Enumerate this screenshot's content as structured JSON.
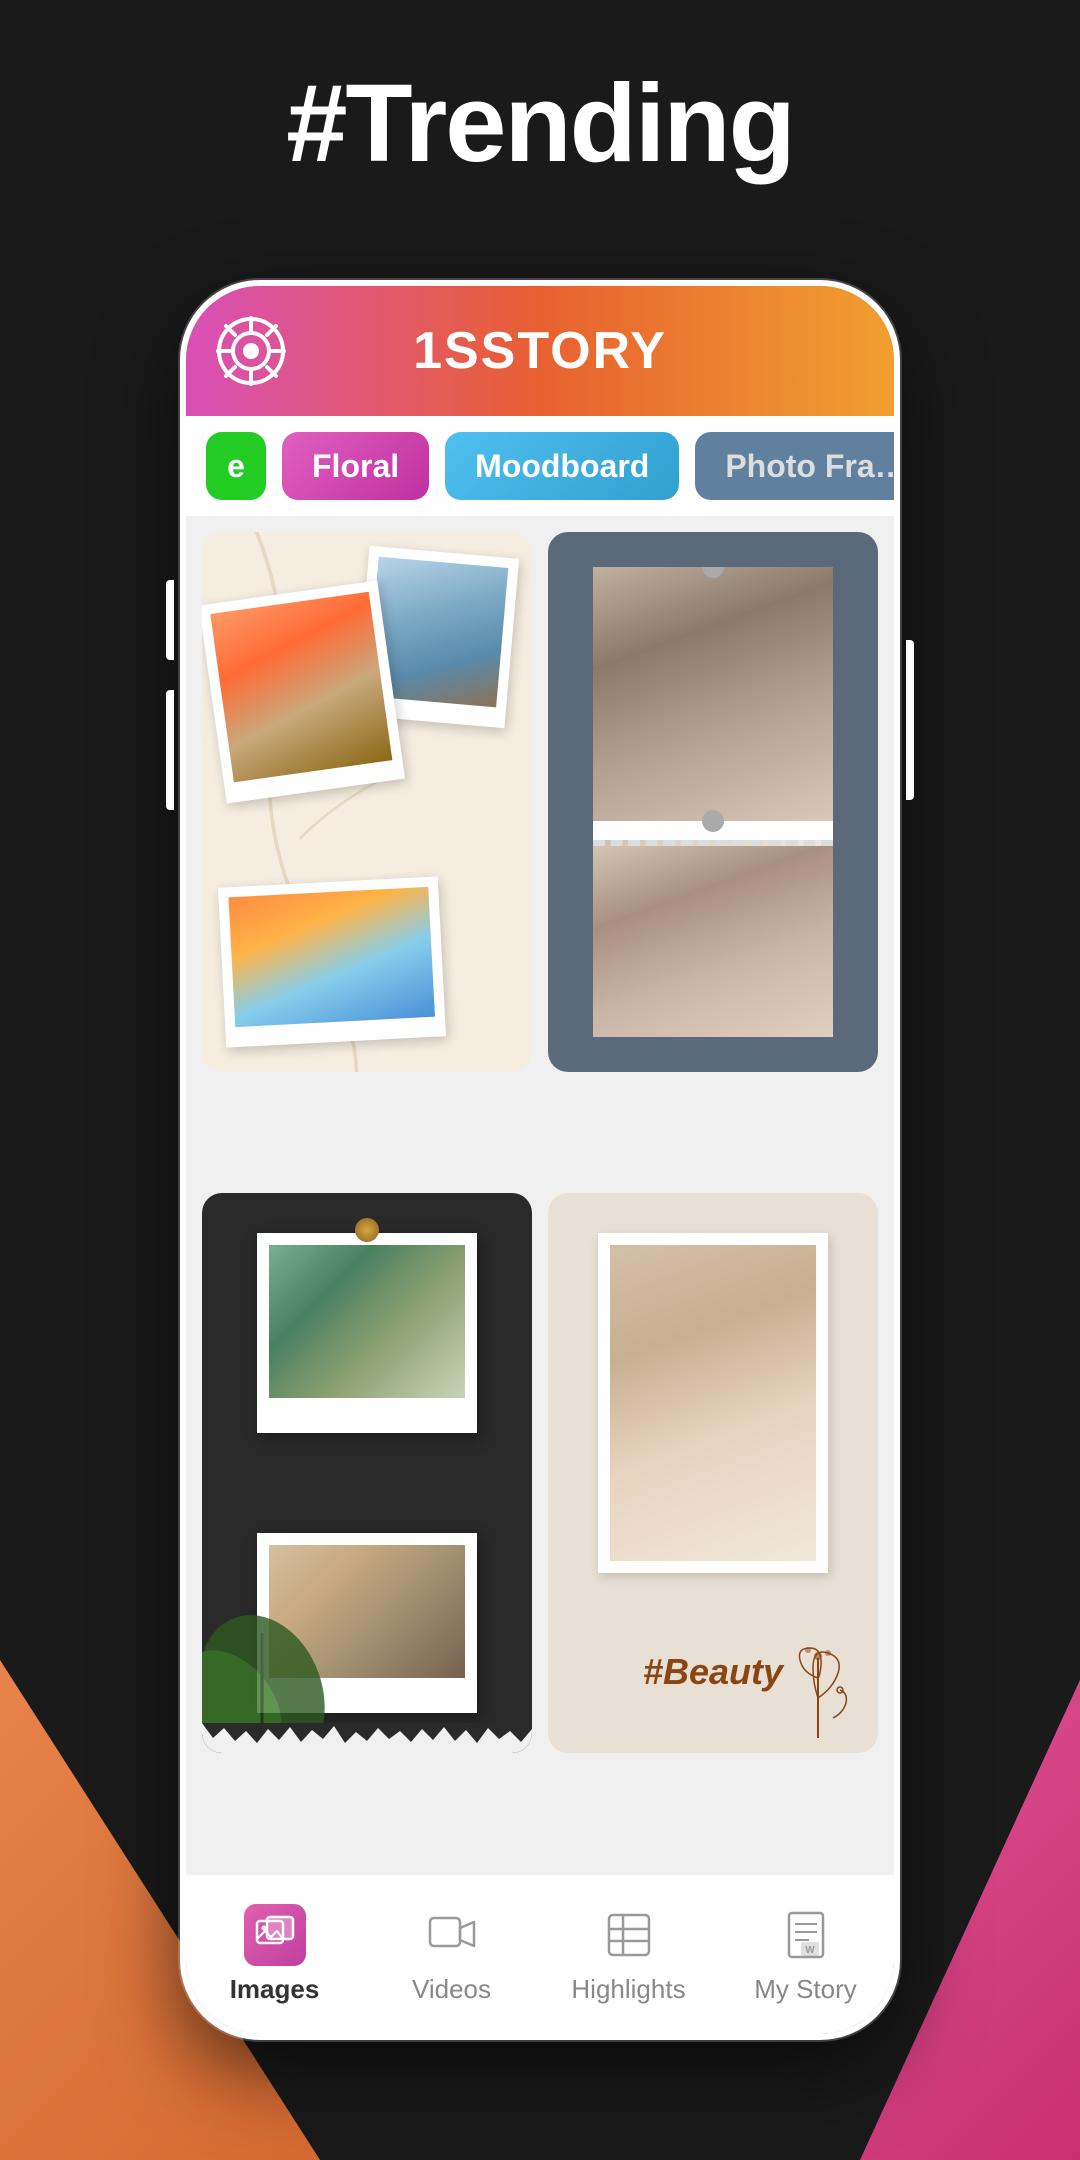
{
  "page": {
    "trending_label": "#Trending",
    "app_title": "1SSTORY"
  },
  "filter_tabs": [
    {
      "id": "tab-e",
      "label": "e",
      "style": "green"
    },
    {
      "id": "tab-floral",
      "label": "Floral",
      "style": "pink"
    },
    {
      "id": "tab-moodboard",
      "label": "Moodboard",
      "style": "blue",
      "active": true
    },
    {
      "id": "tab-photoframe",
      "label": "Photo Fra…",
      "style": "slate"
    }
  ],
  "templates": [
    {
      "id": "tpl-1",
      "type": "polaroid-cluster",
      "bg": "cream"
    },
    {
      "id": "tpl-2",
      "type": "film-strip",
      "bg": "dark-gray"
    },
    {
      "id": "tpl-3",
      "type": "tape-photos",
      "bg": "black"
    },
    {
      "id": "tpl-4",
      "type": "beauty",
      "bg": "beige",
      "tag": "#Beauty"
    }
  ],
  "bottom_nav": [
    {
      "id": "nav-images",
      "label": "Images",
      "active": true,
      "icon": "images-icon"
    },
    {
      "id": "nav-videos",
      "label": "Videos",
      "active": false,
      "icon": "videos-icon"
    },
    {
      "id": "nav-highlights",
      "label": "Highlights",
      "active": false,
      "icon": "highlights-icon"
    },
    {
      "id": "nav-mystory",
      "label": "My Story",
      "active": false,
      "icon": "mystory-icon"
    }
  ]
}
